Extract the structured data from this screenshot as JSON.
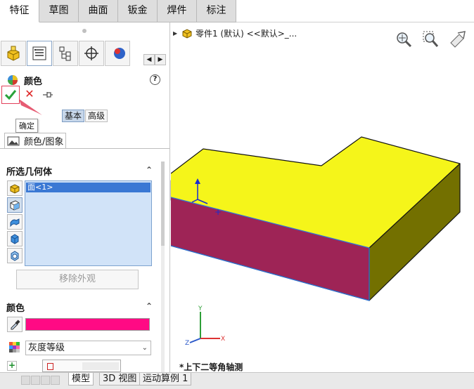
{
  "tabs": [
    {
      "label": "特征",
      "active": true
    },
    {
      "label": "草图",
      "active": false
    },
    {
      "label": "曲面",
      "active": false
    },
    {
      "label": "钣金",
      "active": false
    },
    {
      "label": "焊件",
      "active": false
    },
    {
      "label": "标注",
      "active": false
    }
  ],
  "property_manager": {
    "title": "颜色",
    "help_glyph": "?",
    "ok_tooltip": "确定",
    "cancel_glyph": "✕",
    "mode_basic": "基本",
    "mode_advanced": "高级",
    "subtab_label": "颜色/图象",
    "selected_geometry": {
      "heading": "所选几何体",
      "collapse_glyph": "⌃",
      "items": [
        "面<1>"
      ],
      "remove_button": "移除外观"
    },
    "color": {
      "heading": "颜色",
      "collapse_glyph": "⌃",
      "swatch_color": "#ff0a84",
      "palette_select": "灰度等级",
      "chevron": "⌄",
      "add_glyph": "+"
    }
  },
  "graphics": {
    "tree_item": "零件1 (默认) <<默认>_...",
    "view_label": "*上下二等角轴测",
    "triad_labels": {
      "x": "X",
      "y": "Y",
      "z": "Z"
    },
    "colors": {
      "top_face": "#f5f51a",
      "front_face": "#9e2456",
      "side_face": "#737000",
      "edge": "#2e73d6"
    }
  },
  "bottom_tabs": [
    "模型",
    "3D 视图",
    "运动算例 1"
  ]
}
